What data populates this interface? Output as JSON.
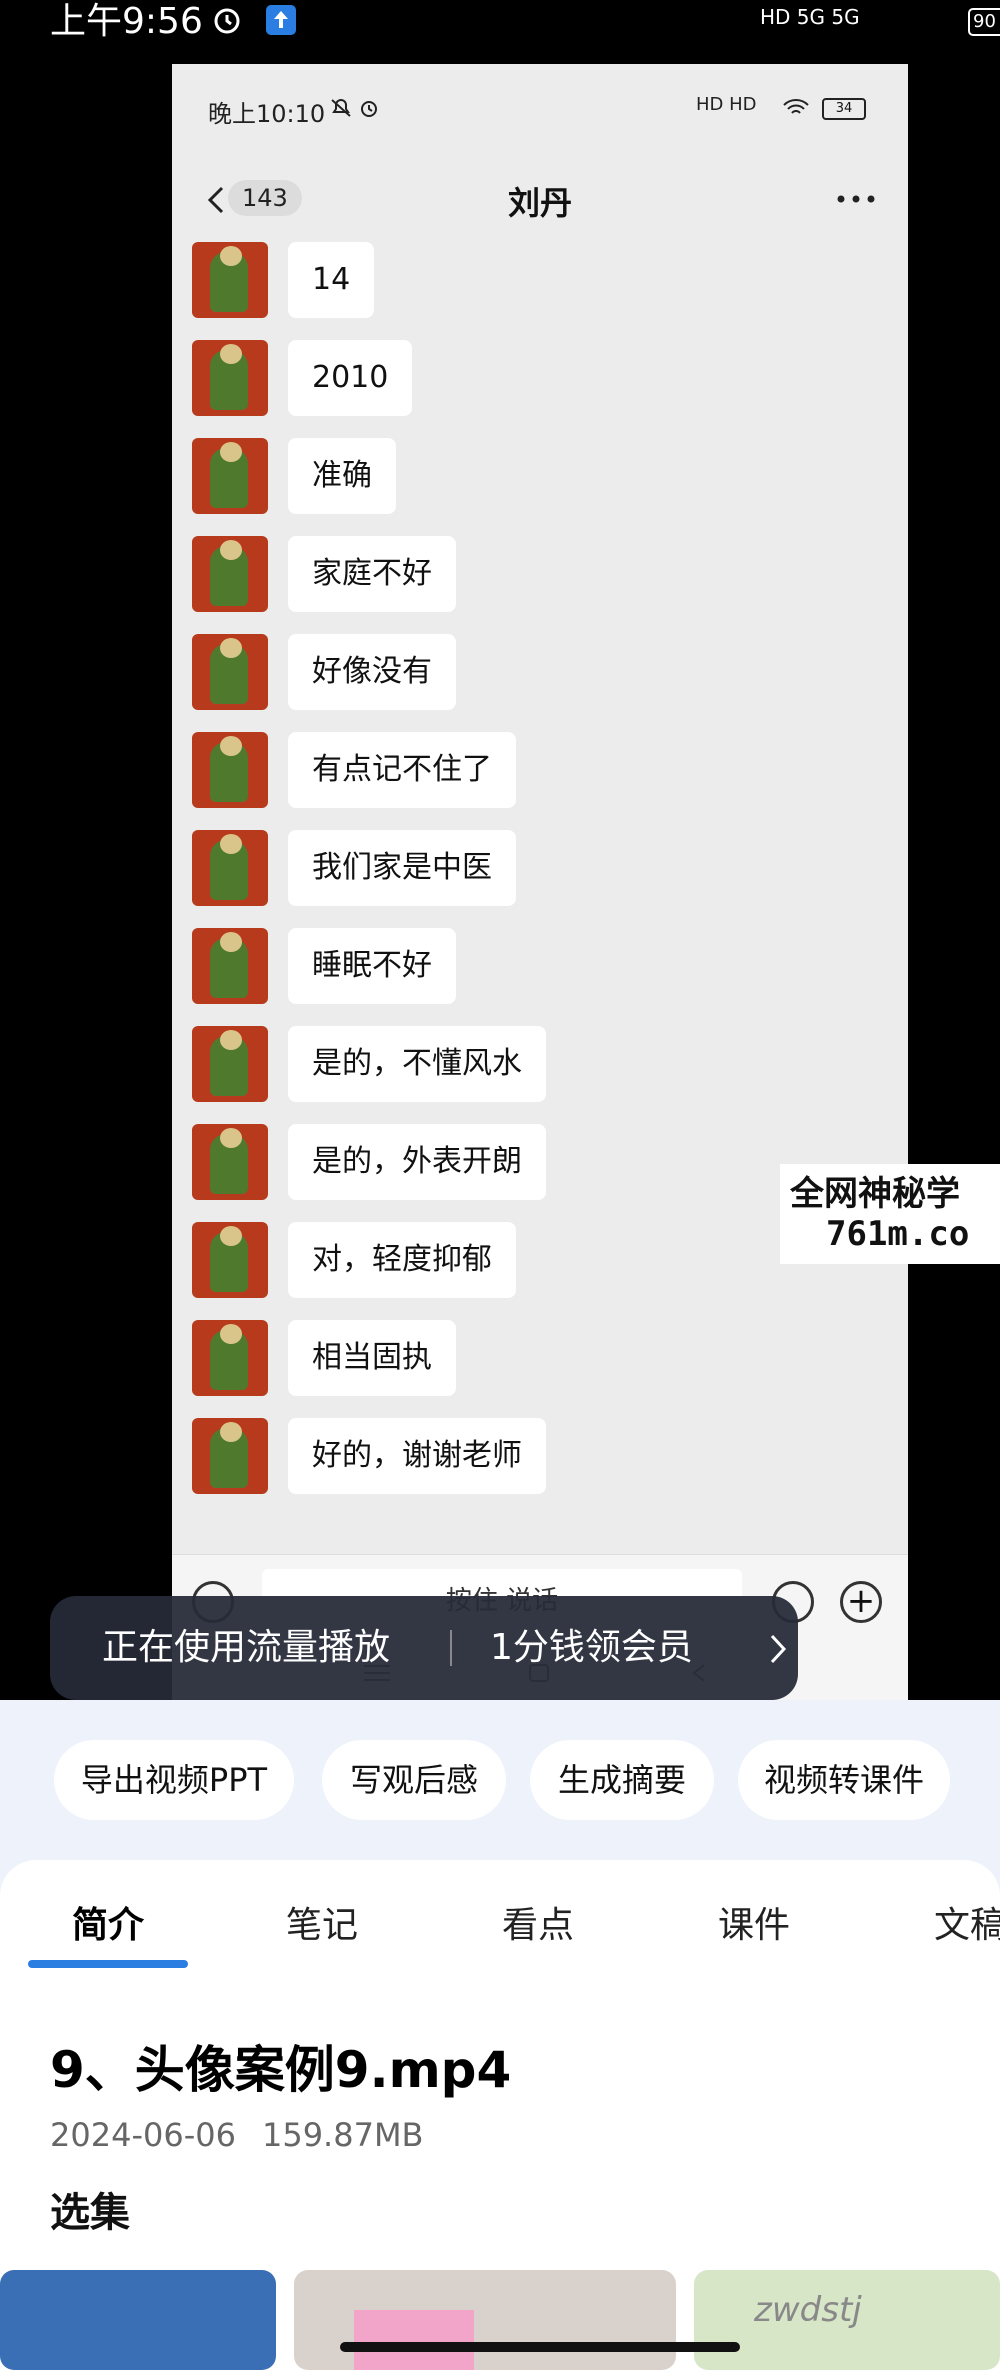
{
  "status_bar": {
    "time": "上午9:56",
    "network": "HD 5G 5G",
    "battery": "90"
  },
  "chat": {
    "status_time": "晚上10:10",
    "signal": "HD HD",
    "battery": "34",
    "unread_count": "143",
    "contact_name": "刘丹",
    "messages": [
      "14",
      "2010",
      "准确",
      "家庭不好",
      "好像没有",
      "有点记不住了",
      "我们家是中医",
      "睡眠不好",
      "是的，不懂风水",
      "是的，外表开朗",
      "对，轻度抑郁",
      "相当固执",
      "好的，谢谢老师"
    ],
    "input_placeholder": "按住 说话"
  },
  "watermark": {
    "line1": "全网神秘学",
    "line2": "761m.co"
  },
  "toast": {
    "text": "正在使用流量播放",
    "action": "1分钱领会员"
  },
  "playback_progress": 0.02,
  "actions": [
    "导出视频PPT",
    "写观后感",
    "生成摘要",
    "视频转课件"
  ],
  "tabs": [
    "简介",
    "笔记",
    "看点",
    "课件",
    "文稿"
  ],
  "active_tab": "简介",
  "video": {
    "title": "9、头像案例9.mp4",
    "date": "2024-06-06",
    "size": "159.87MB"
  },
  "episodes_label": "选集",
  "thumb_text": "zwdstj",
  "colors": {
    "accent": "#2a7de1",
    "avatar": "#b83a1c"
  }
}
